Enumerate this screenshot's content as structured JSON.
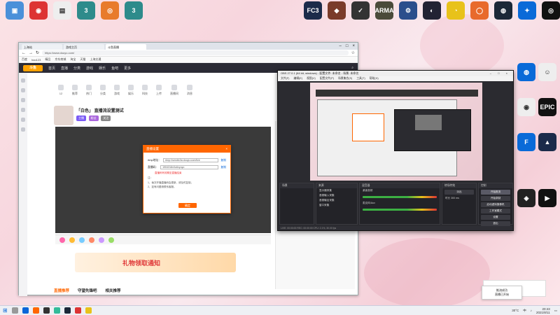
{
  "desktop_left_icons": [
    {
      "label": "",
      "color": "#4a90d9",
      "glyph": "▣"
    },
    {
      "label": "",
      "color": "#d33",
      "glyph": "◉"
    },
    {
      "label": "",
      "color": "#eee",
      "glyph": "▤"
    },
    {
      "label": "",
      "color": "#2e8b8b",
      "glyph": "3"
    },
    {
      "label": "",
      "color": "#e87b2c",
      "glyph": "◎"
    },
    {
      "label": "",
      "color": "#2e8b8b",
      "glyph": "3"
    }
  ],
  "desktop_top_right_icons": [
    {
      "label": "",
      "color": "#1b2b4a",
      "glyph": "FC3"
    },
    {
      "label": "",
      "color": "#7a3b2a",
      "glyph": "◆"
    },
    {
      "label": "",
      "color": "#333",
      "glyph": "✓"
    },
    {
      "label": "",
      "color": "#4a4a3a",
      "glyph": "ARMA"
    },
    {
      "label": "",
      "color": "#2b4e8c",
      "glyph": "⚙"
    },
    {
      "label": "",
      "color": "#223",
      "glyph": "◐"
    },
    {
      "label": "",
      "color": "#e8c21a",
      "glyph": "◔"
    },
    {
      "label": "",
      "color": "#e86a2c",
      "glyph": "◯"
    },
    {
      "label": "",
      "color": "#1b2838",
      "glyph": "◍"
    },
    {
      "label": "",
      "color": "#0a6ad8",
      "glyph": "✦"
    },
    {
      "label": "",
      "color": "#111",
      "glyph": "◎"
    }
  ],
  "desktop_right_icons": [
    {
      "label": "",
      "color": "#0a6ad8",
      "glyph": "◍"
    },
    {
      "label": "",
      "color": "#eee",
      "glyph": "☺"
    },
    {
      "label": "",
      "color": "#eee",
      "glyph": "◉"
    },
    {
      "label": "",
      "color": "#111",
      "glyph": "EPIC"
    },
    {
      "label": "",
      "color": "#0a6ad8",
      "glyph": "F"
    },
    {
      "label": "",
      "color": "#1b2b4a",
      "glyph": "▲"
    },
    {
      "label": "",
      "color": "#222",
      "glyph": "◈"
    },
    {
      "label": "",
      "color": "#111",
      "glyph": "▶"
    }
  ],
  "browser": {
    "tabs": [
      "上海站",
      "游戏主页",
      "斗鱼直播"
    ],
    "url": "https://www.douyu.com/",
    "bookmarks": [
      "百度",
      "hao123",
      "精品",
      "京东商城",
      "淘宝",
      "天猫",
      "上海交通"
    ],
    "site_nav": [
      "首页",
      "直播",
      "分类",
      "游戏",
      "娱乐",
      "鱼吧",
      "更多"
    ],
    "logo": "斗鱼",
    "categories": [
      "12",
      "推荐",
      "热门",
      "分类",
      "游戏",
      "娱乐",
      "科技",
      "上传",
      "直播间",
      "消息"
    ],
    "room_title": "「白色」 直播流设置测试",
    "chips": [
      "主播",
      "粉丝",
      "关注"
    ],
    "dialog": {
      "title": "直播设置",
      "rtmp_label": "rtmp地址：",
      "rtmp_value": "rtmp://sendtc3a.douyu.com/live",
      "copy1": "复制",
      "key_label": "直播码：",
      "key_value": "1904318v0u6vyuyu",
      "copy2": "复制",
      "warn": "直播码有效期至直播结束",
      "note_title": "注：",
      "note_1": "1、每次开播直播码会更新，请及时复制。",
      "note_2": "2、如有问题请联系客服。",
      "confirm": "确定"
    },
    "banner_text": "礼物领取通知",
    "section_tabs": [
      "直播推荐",
      "守望先锋吧",
      "相关推荐"
    ]
  },
  "obs": {
    "title": "OBS 27.0.1 (64 bit, windows) - 配置文件: 未命名 - 场景: 未命名",
    "menu": [
      "文件(F)",
      "编辑(E)",
      "视图(V)",
      "配置文件(P)",
      "场景集合(S)",
      "工具(T)",
      "帮助(H)"
    ],
    "docks": {
      "scenes": "场景",
      "sources": "来源",
      "mixer": "混音器",
      "transitions": "转场特效",
      "controls": "控制"
    },
    "sources": [
      "显示器采集",
      "音频输入采集",
      "音频输出采集",
      "窗口采集"
    ],
    "mixer_channels": [
      "桌面音频",
      "麦克风/Aux"
    ],
    "transition_value": "淡出",
    "duration_label": "时长",
    "duration_value": "300 ms",
    "controls": [
      "开始推流",
      "开始录制",
      "启动虚拟摄像机",
      "工作室模式",
      "设置",
      "退出"
    ],
    "status": "LIVE: 00:00:00   REC: 00:00:00   CPU: 2.1%, 30.00 fps"
  },
  "taskbar": {
    "time": "20:43",
    "date": "2021/8/11",
    "temp": "30°C",
    "lang": "中"
  },
  "toast": {
    "line1": "推流成功",
    "line2": "直播已开始"
  },
  "colors": {
    "douyu_orange": "#ff6600",
    "obs_dark": "#2b2b30",
    "taskbar": "#eef0f4"
  }
}
